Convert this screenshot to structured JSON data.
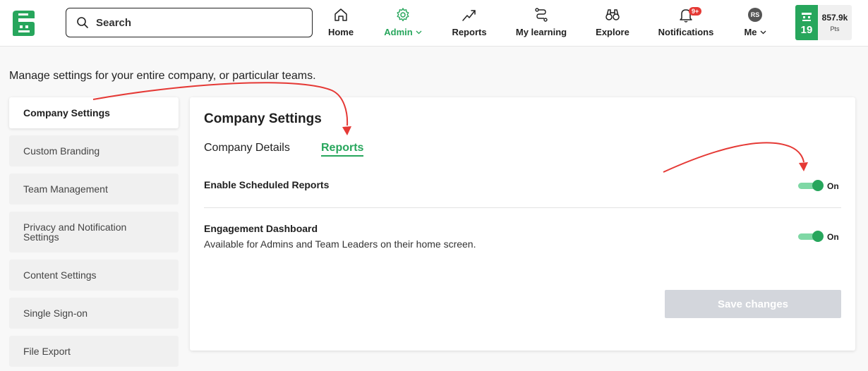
{
  "header": {
    "search_placeholder": "Search",
    "nav": [
      {
        "label": "Home",
        "icon": "home-icon"
      },
      {
        "label": "Admin",
        "icon": "gear-icon",
        "active": true
      },
      {
        "label": "Reports",
        "icon": "trend-icon"
      },
      {
        "label": "My learning",
        "icon": "path-icon"
      },
      {
        "label": "Explore",
        "icon": "binoculars-icon"
      },
      {
        "label": "Notifications",
        "icon": "bell-icon"
      },
      {
        "label": "Me",
        "icon": "avatar"
      }
    ],
    "notification_badge": "9+",
    "avatar_initials": "RS",
    "level": "19",
    "points": "857.9k",
    "points_unit": "Pts"
  },
  "intro_text": "Manage settings for your entire company, or particular teams.",
  "sidebar": {
    "items": [
      {
        "label": "Company Settings",
        "active": true
      },
      {
        "label": "Custom Branding"
      },
      {
        "label": "Team Management"
      },
      {
        "label": "Privacy and Notification Settings"
      },
      {
        "label": "Content Settings"
      },
      {
        "label": "Single Sign-on"
      },
      {
        "label": "File Export"
      }
    ]
  },
  "panel": {
    "title": "Company Settings",
    "tabs": [
      {
        "label": "Company Details"
      },
      {
        "label": "Reports",
        "active": true
      }
    ],
    "settings": [
      {
        "label": "Enable Scheduled Reports",
        "description": "",
        "state": "On"
      },
      {
        "label": "Engagement Dashboard",
        "description": "Available for Admins and Team Leaders on their home screen.",
        "state": "On"
      }
    ],
    "save_label": "Save changes"
  },
  "colors": {
    "accent": "#27a65c",
    "toggle_track": "#7fd8a5",
    "annotation_arrow": "#e53935",
    "save_disabled": "#d3d6dc"
  }
}
